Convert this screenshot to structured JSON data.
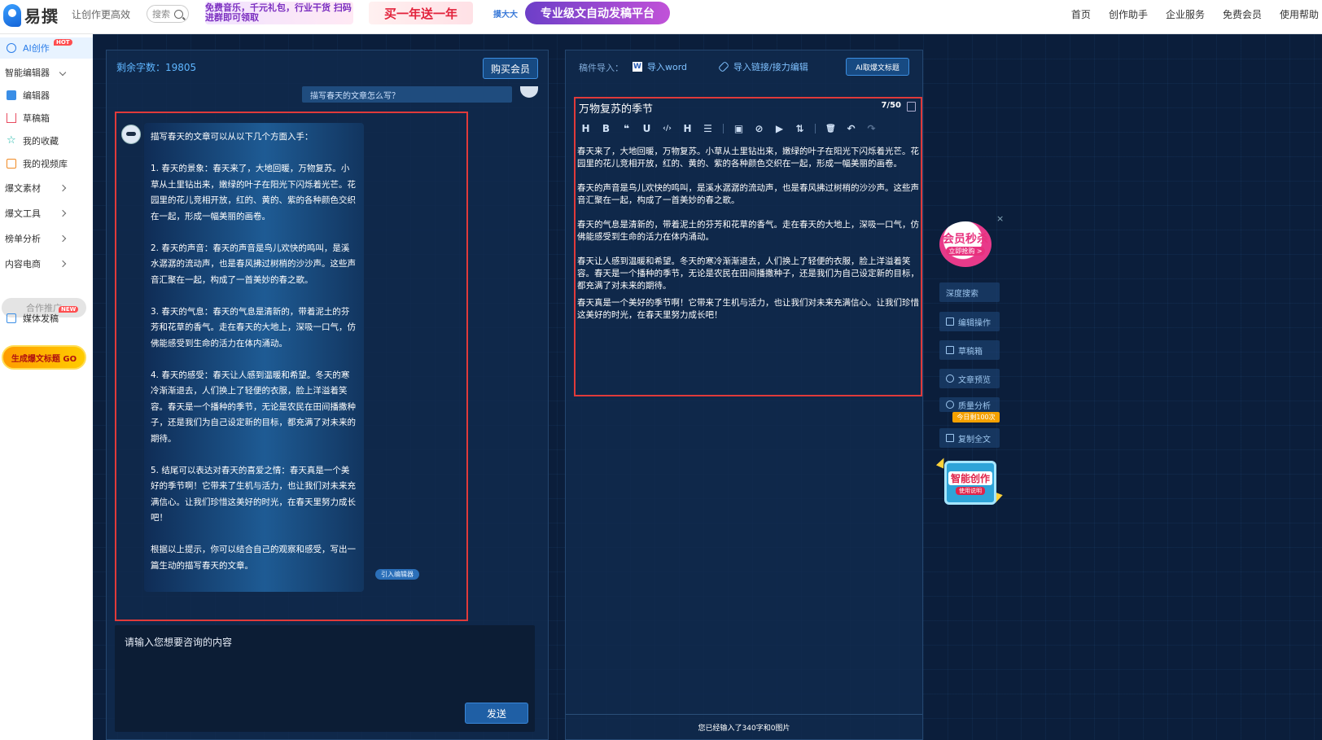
{
  "header": {
    "logo_text": "易撰",
    "slogan": "让创作更高效",
    "search_placeholder": "搜索",
    "banners": [
      "免费音乐，千元礼包，行业干货 扫码进群即可领取",
      "买一年送一年",
      "摸大大",
      "专业级文自动发稿平台"
    ],
    "nav": [
      "首页",
      "创作助手",
      "企业服务",
      "免费会员",
      "使用帮助"
    ]
  },
  "sidebar": {
    "ai_create": "AI创作",
    "hot_badge": "HOT",
    "smart_editor": "智能编辑器",
    "editor_items": [
      "编辑器",
      "草稿箱",
      "我的收藏",
      "我的视频库"
    ],
    "groups": [
      "爆文素材",
      "爆文工具",
      "榜单分析",
      "内容电商"
    ],
    "cooperation": "合作推广",
    "media_publish": "媒体发稿",
    "new_badge": "NEW",
    "promo": "生成爆文标题 GO"
  },
  "chat": {
    "words_left_label": "剩余字数：19805",
    "buy_label": "购买会员",
    "user_question": "描写春天的文章怎么写？",
    "answer_paragraphs": [
      "描写春天的文章可以从以下几个方面入手：",
      "1. 春天的景象：春天来了，大地回暖，万物复苏。小草从土里钻出来，嫩绿的叶子在阳光下闪烁着光芒。花园里的花儿竞相开放，红的、黄的、紫的各种颜色交织在一起，形成一幅美丽的画卷。",
      "2. 春天的声音：春天的声音是鸟儿欢快的鸣叫，是溪水潺潺的流动声，也是春风拂过树梢的沙沙声。这些声音汇聚在一起，构成了一首美妙的春之歌。",
      "3. 春天的气息：春天的气息是清新的，带着泥土的芬芳和花草的香气。走在春天的大地上，深吸一口气，仿佛能感受到生命的活力在体内涌动。",
      "4. 春天的感受：春天让人感到温暖和希望。冬天的寒冷渐渐退去，人们换上了轻便的衣服，脸上洋溢着笑容。春天是一个播种的季节，无论是农民在田间播撒种子，还是我们为自己设定新的目标，都充满了对未来的期待。",
      "5. 结尾可以表达对春天的喜爱之情：春天真是一个美好的季节啊！它带来了生机与活力，也让我们对未来充满信心。让我们珍惜这美好的时光，在春天里努力成长吧！",
      "根据以上提示，你可以结合自己的观察和感受，写出一篇生动的描写春天的文章。"
    ],
    "quote_label": "引入编辑器",
    "input_placeholder": "请输入您想要咨询的内容",
    "send_label": "发送"
  },
  "editor": {
    "import_label": "稿件导入：",
    "import_word": "导入word",
    "import_link": "导入链接/接力编辑",
    "ai_title": "AI取爆文标题",
    "doc_title": "万物复苏的季节",
    "title_count": "7/50",
    "toolbar": [
      "H",
      "B",
      "❝",
      "U",
      "‹/›",
      "H",
      "☰",
      "▣",
      "⊘",
      "▶",
      "⇅",
      "🗑",
      "↶",
      "↷"
    ],
    "body_paragraphs": [
      "春天来了，大地回暖，万物复苏。小草从土里钻出来，嫩绿的叶子在阳光下闪烁着光芒。花园里的花儿竞相开放，红的、黄的、紫的各种颜色交织在一起，形成一幅美丽的画卷。",
      "春天的声音是鸟儿欢快的鸣叫，是溪水潺潺的流动声，也是春风拂过树梢的沙沙声。这些声音汇聚在一起，构成了一首美妙的春之歌。",
      "春天的气息是清新的，带着泥土的芬芳和花草的香气。走在春天的大地上，深吸一口气，仿佛能感受到生命的活力在体内涌动。",
      "春天让人感到温暖和希望。冬天的寒冷渐渐退去，人们换上了轻便的衣服，脸上洋溢着笑容。春天是一个播种的季节，无论是农民在田间播撒种子，还是我们为自己设定新的目标，都充满了对未来的期待。",
      "春天真是一个美好的季节啊！它带来了生机与活力，也让我们对未来充满信心。让我们珍惜这美好的时光，在春天里努力成长吧！"
    ],
    "footer": "您已经输入了340字和0图片"
  },
  "right_tools": {
    "vip_title": "会员秒杀",
    "vip_sub": "立即抢购 >",
    "close": "×",
    "items": [
      "深度搜索",
      "编辑操作",
      "草稿箱",
      "文章预览",
      "质量分析",
      "复制全文"
    ],
    "quota_tag": "今日剩100次",
    "smart_title": "智能创作",
    "smart_sub": "使用说明"
  },
  "colors": {
    "accent": "#2b7de9",
    "highlight_border": "#e03a3a",
    "panel_bg": "#102a4e",
    "page_bg": "#0b1e3b"
  }
}
